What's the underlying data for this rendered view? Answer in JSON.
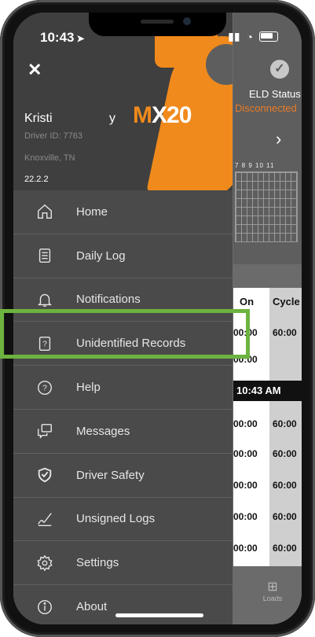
{
  "status_bar": {
    "time": "10:43"
  },
  "background_app": {
    "eld_status_label": "ELD Status",
    "eld_status_value": "Disconnected",
    "grid_ticks": "7 8 9 10 11",
    "table_headers": {
      "on": "On",
      "cycle": "Cycle"
    },
    "row1": {
      "on": "00:00",
      "cycle": "60:00"
    },
    "row2": {
      "on": "00:00"
    },
    "time_bar": "10:43 AM",
    "rows": [
      {
        "on": "00:00",
        "cycle": "60:00"
      },
      {
        "on": "00:00",
        "cycle": "60:00"
      },
      {
        "on": "00:00",
        "cycle": "60:00"
      },
      {
        "on": "00:00",
        "cycle": "60:00"
      },
      {
        "on": "00:00",
        "cycle": "60:00"
      }
    ],
    "loads_label": "Loads"
  },
  "drawer": {
    "close_icon": "close-icon",
    "logo": {
      "prefix": "M",
      "text": "X20"
    },
    "driver_name": "Kristi",
    "driver_name_tail": "y",
    "driver_id": "Driver ID: 7763",
    "location": "Knoxville, TN",
    "version": "22.2.2",
    "items": [
      {
        "label": "Home",
        "icon": "home-icon"
      },
      {
        "label": "Daily Log",
        "icon": "log-icon"
      },
      {
        "label": "Notifications",
        "icon": "bell-icon"
      },
      {
        "label": "Unidentified Records",
        "icon": "unidentified-icon"
      },
      {
        "label": "Help",
        "icon": "help-icon"
      },
      {
        "label": "Messages",
        "icon": "messages-icon"
      },
      {
        "label": "Driver Safety",
        "icon": "shield-icon"
      },
      {
        "label": "Unsigned Logs",
        "icon": "signature-icon"
      },
      {
        "label": "Settings",
        "icon": "gear-icon"
      },
      {
        "label": "About",
        "icon": "info-icon"
      }
    ]
  },
  "colors": {
    "accent": "#f08a1c",
    "highlight": "#6cb33f",
    "drawer_bg": "#4a4a4a"
  }
}
